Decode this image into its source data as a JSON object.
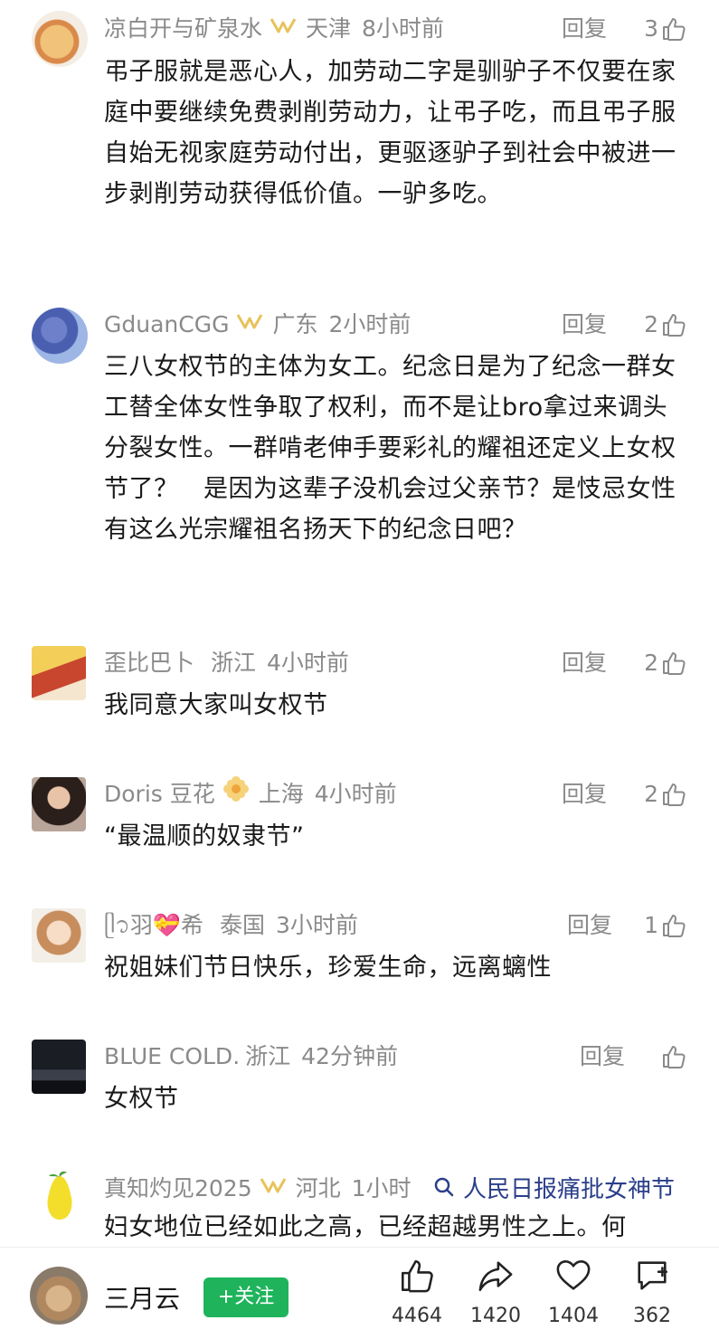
{
  "comments": [
    {
      "name": "凉白开与矿泉水",
      "location": "天津",
      "time": "8小时前",
      "reply": "回复",
      "likes": "3",
      "text": "弔子服就是恶心人，加劳动二字是驯驴子不仅要在家庭中要继续免费剥削劳动力，让弔子吃，而且弔子服自始无视家庭劳动付出，更驱逐驴子到社会中被进一步剥削劳动获得低价值。一驴多吃。"
    },
    {
      "name": "GduanCGG",
      "location": "广东",
      "time": "2小时前",
      "reply": "回复",
      "likes": "2",
      "text": "三八女权节的主体为女工。纪念日是为了纪念一群女工替全体女性争取了权利，而不是让bro拿过来调头分裂女性。一群啃老伸手要彩礼的耀祖还定义上女权节了？　是因为这辈子没机会过父亲节？是忮忌女性有这么光宗耀祖名扬天下的纪念日吧？"
    },
    {
      "name": "歪比巴卜",
      "location": "浙江",
      "time": "4小时前",
      "reply": "回复",
      "likes": "2",
      "text": "我同意大家叫女权节"
    },
    {
      "name": "Doris 豆花",
      "location": "上海",
      "time": "4小时前",
      "reply": "回复",
      "likes": "2",
      "text": "“最温顺的奴隶节”"
    },
    {
      "name": "ᥫ᭡羽💝希",
      "location": "泰国",
      "time": "3小时前",
      "reply": "回复",
      "likes": "1",
      "text": "祝姐妹们节日快乐，珍爱生命，远离螭性"
    },
    {
      "name": "BLUE COLD.",
      "location": "浙江",
      "time": "42分钟前",
      "reply": "回复",
      "likes": "",
      "text": "女权节"
    },
    {
      "name": "真知灼见2025",
      "location": "河北",
      "time": "1小时",
      "reply": "",
      "likes": "",
      "text": "妇女地位已经如此之高，已经超越男性之上。何"
    }
  ],
  "search_suggestion": "人民日报痛批女神节",
  "author": {
    "name": "三月云",
    "follow_label": "+关注"
  },
  "actions": {
    "like_count": "4464",
    "share_count": "1420",
    "favorite_count": "1404",
    "comment_count": "362"
  },
  "colors": {
    "meta_gray": "#8a8a8a",
    "follow_green": "#1fb45c",
    "search_blue": "#2b3f8a",
    "badge_gold": "#e8c25a"
  },
  "icons": [
    "thumbs-up-icon",
    "share-icon",
    "heart-icon",
    "comment-add-icon",
    "search-icon",
    "vip-badge-icon"
  ]
}
